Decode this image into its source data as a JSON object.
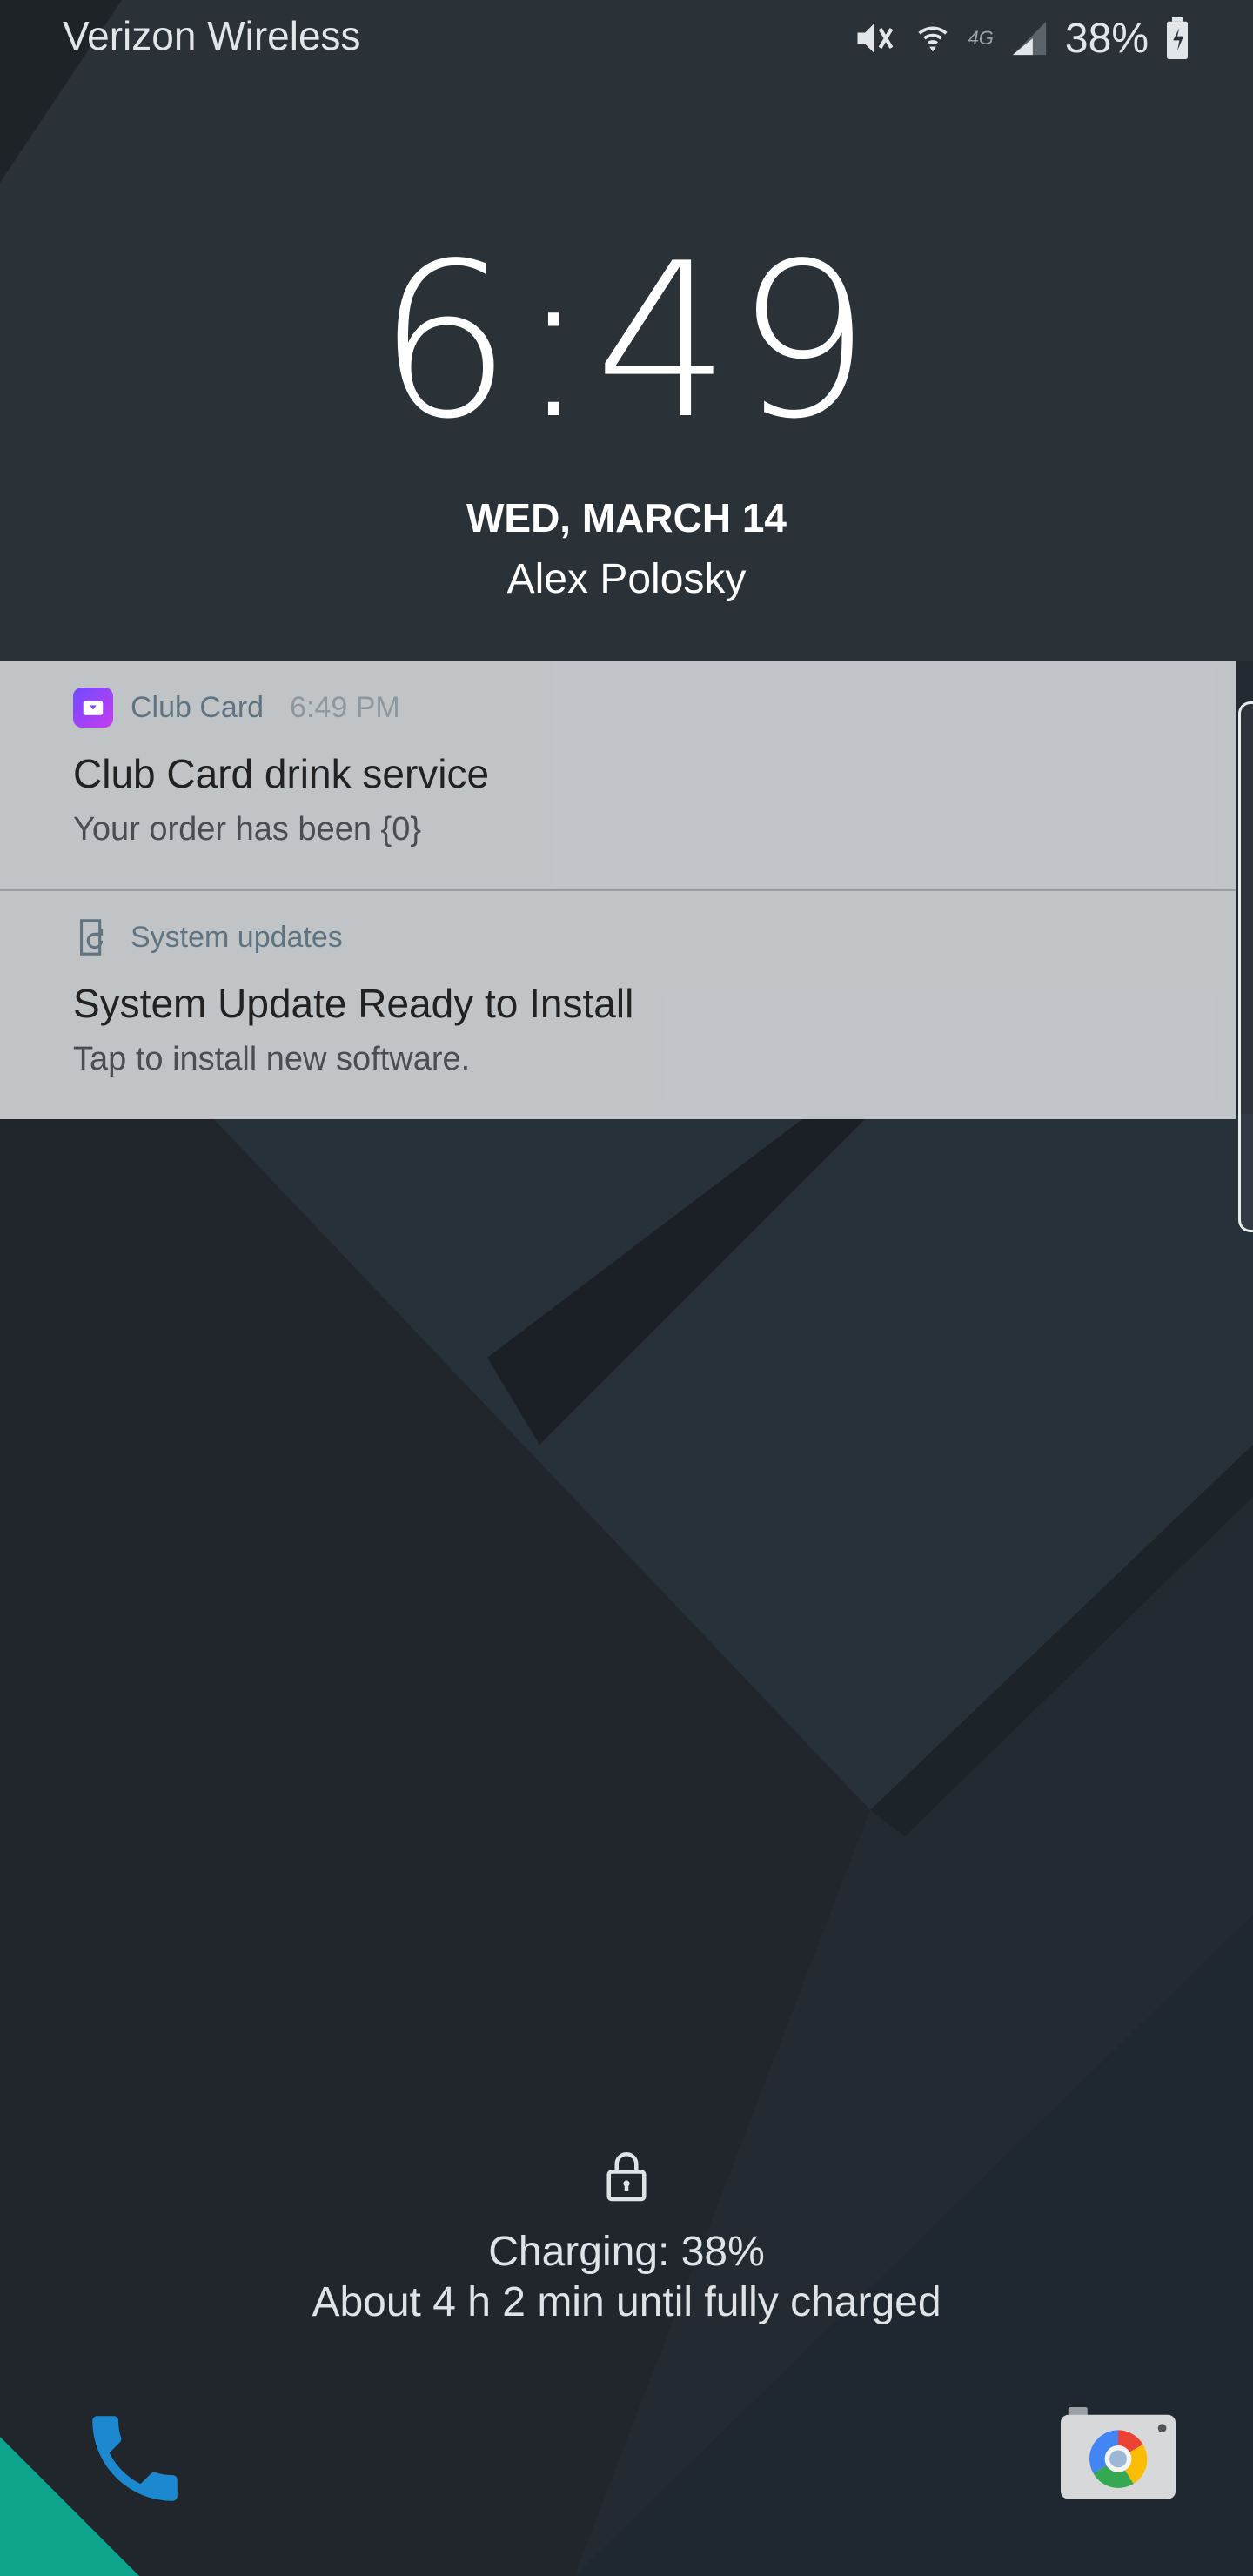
{
  "status_bar": {
    "carrier": "Verizon Wireless",
    "network": "4G",
    "battery_percent": "38%",
    "icons": [
      "mute-icon",
      "wifi-icon",
      "lte-icon",
      "signal-icon",
      "battery-charging-icon"
    ]
  },
  "lockscreen": {
    "time": "6:49",
    "date": "WED, MARCH 14",
    "owner": "Alex Polosky"
  },
  "notifications": [
    {
      "app": "Club Card",
      "time": "6:49 PM",
      "title": "Club Card drink service",
      "text": "Your order has been {0}",
      "icon": "club-card-app-icon"
    },
    {
      "app": "System updates",
      "title": "System Update Ready to Install",
      "text": "Tap to install new software.",
      "icon": "system-update-icon"
    }
  ],
  "charging": {
    "status": "Charging: 38%",
    "eta": "About 4 h 2 min until fully charged"
  },
  "shortcuts": {
    "left": "phone-icon",
    "right": "camera-icon"
  },
  "colors": {
    "wallpaper_dark": "#1f252b",
    "wallpaper_mid": "#2a333a",
    "accent_teal": "#0fa58c",
    "phone_blue": "#1b88d0"
  }
}
